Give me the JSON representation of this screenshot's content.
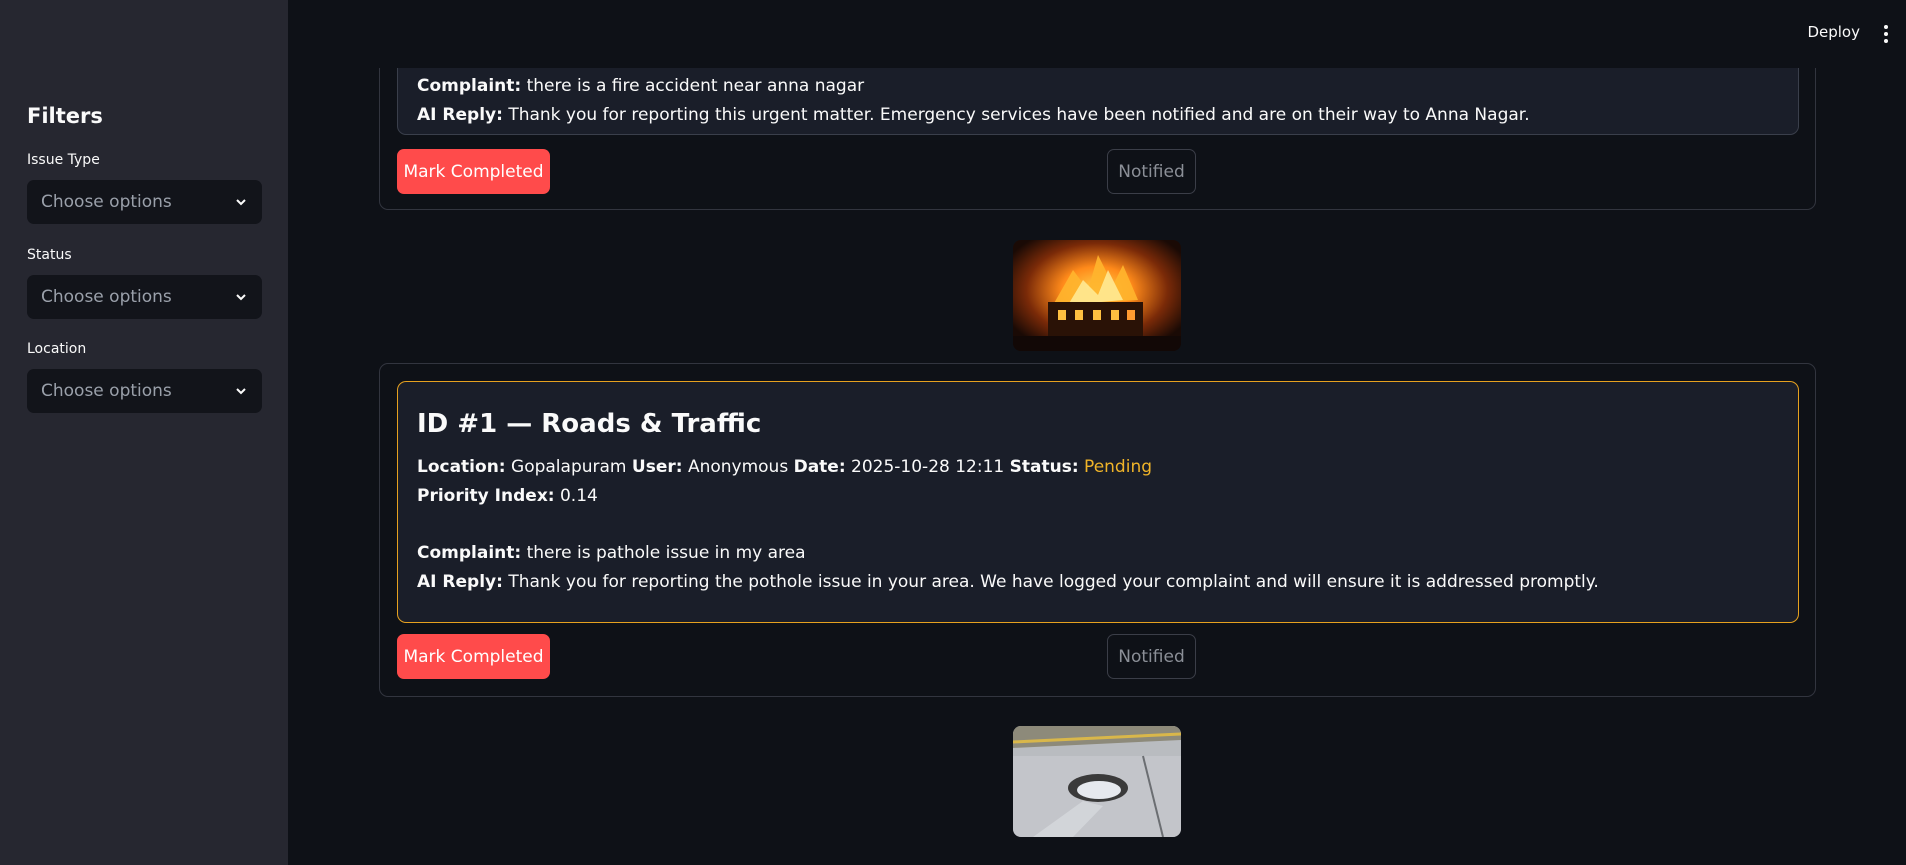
{
  "topbar": {
    "deploy_label": "Deploy",
    "menu_icon": "vertical-dots-icon"
  },
  "sidebar": {
    "title": "Filters",
    "filters": [
      {
        "label": "Issue Type",
        "placeholder": "Choose options"
      },
      {
        "label": "Status",
        "placeholder": "Choose options"
      },
      {
        "label": "Location",
        "placeholder": "Choose options"
      }
    ]
  },
  "complaints": [
    {
      "complaint_label": "Complaint:",
      "complaint": "there is a fire accident near anna nagar",
      "ai_reply_label": "AI Reply:",
      "ai_reply": "Thank you for reporting this urgent matter. Emergency services have been notified and are on their way to Anna Nagar.",
      "mark_label": "Mark Completed",
      "notified_label": "Notified",
      "image": "burning-house"
    },
    {
      "title": "ID #1 — Roads & Traffic",
      "location_label": "Location:",
      "location": "Gopalapuram",
      "user_label": "User:",
      "user": "Anonymous",
      "date_label": "Date:",
      "date": "2025-10-28 12:11",
      "status_label": "Status:",
      "status": "Pending",
      "status_color": "#f0b429",
      "priority_label": "Priority Index:",
      "priority": "0.14",
      "complaint_label": "Complaint:",
      "complaint": "there is pathole issue in my area",
      "ai_reply_label": "AI Reply:",
      "ai_reply": "Thank you for reporting the pothole issue in your area. We have logged your complaint and will ensure it is addressed promptly.",
      "mark_label": "Mark Completed",
      "notified_label": "Notified",
      "image": "pothole-road"
    }
  ]
}
